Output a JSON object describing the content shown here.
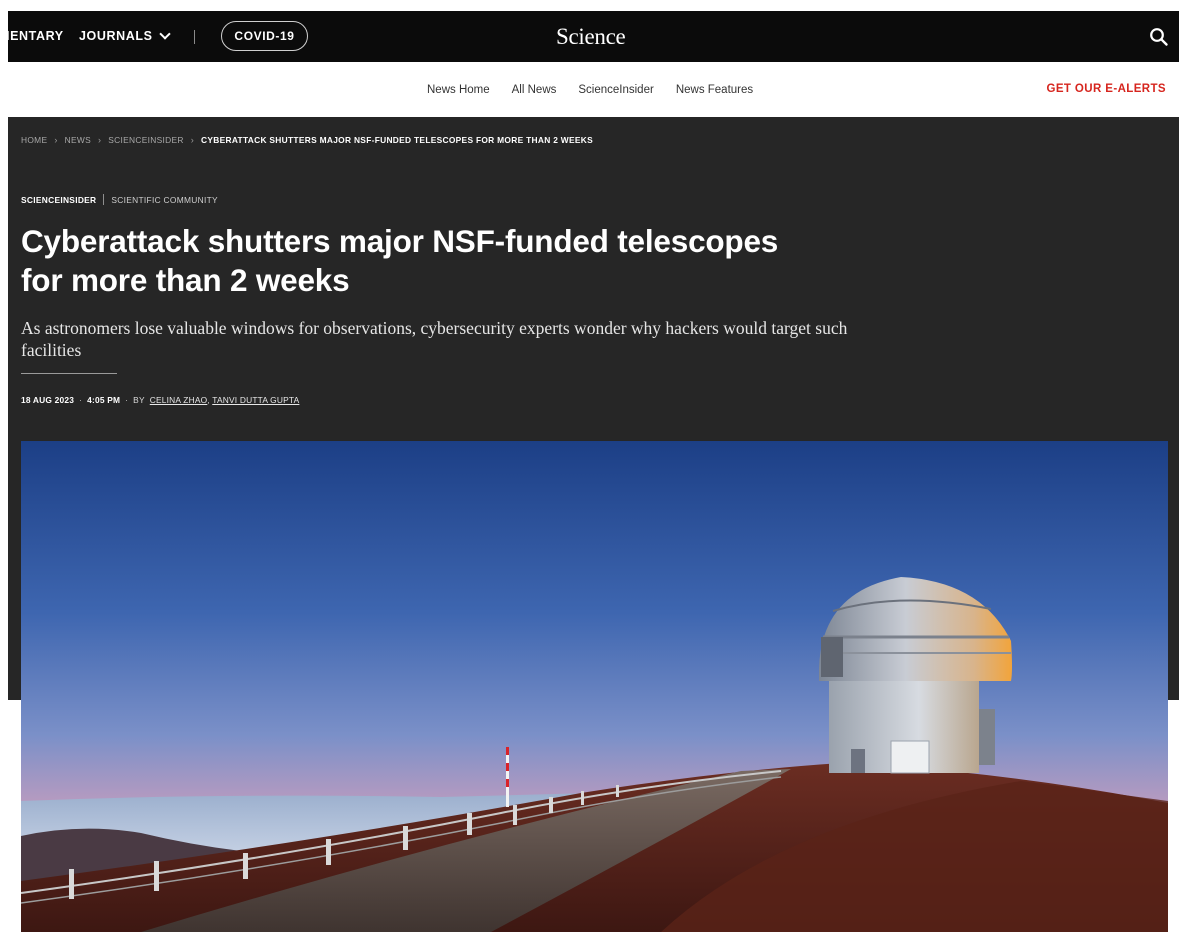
{
  "topbar": {
    "nav_commentary": "IENTARY",
    "nav_journals": "JOURNALS",
    "covid_label": "COVID-19",
    "logo": "Science",
    "search_icon": "search-icon"
  },
  "subnav": {
    "links": [
      "News Home",
      "All News",
      "ScienceInsider",
      "News Features"
    ],
    "alerts": "GET OUR E-ALERTS"
  },
  "breadcrumb": {
    "items": [
      "HOME",
      "NEWS",
      "SCIENCEINSIDER"
    ],
    "current": "CYBERATTACK SHUTTERS MAJOR NSF-FUNDED TELESCOPES FOR MORE THAN 2 WEEKS"
  },
  "article": {
    "kicker_primary": "SCIENCEINSIDER",
    "kicker_secondary": "SCIENTIFIC COMMUNITY",
    "headline_line1": "Cyberattack shutters major NSF-funded telescopes",
    "headline_line2": "for more than 2 weeks",
    "dek": "As astronomers lose valuable windows for observations, cybersecurity experts wonder why hackers would target such facilities",
    "date": "18 AUG 2023",
    "time": "4:05 PM",
    "by": "BY",
    "authors": [
      "CELINA ZHAO",
      "TANVI DUTTA GUPTA"
    ]
  },
  "colors": {
    "topbar_bg": "#0b0b0b",
    "hero_bg": "#262626",
    "alert_red": "#d6251e"
  }
}
